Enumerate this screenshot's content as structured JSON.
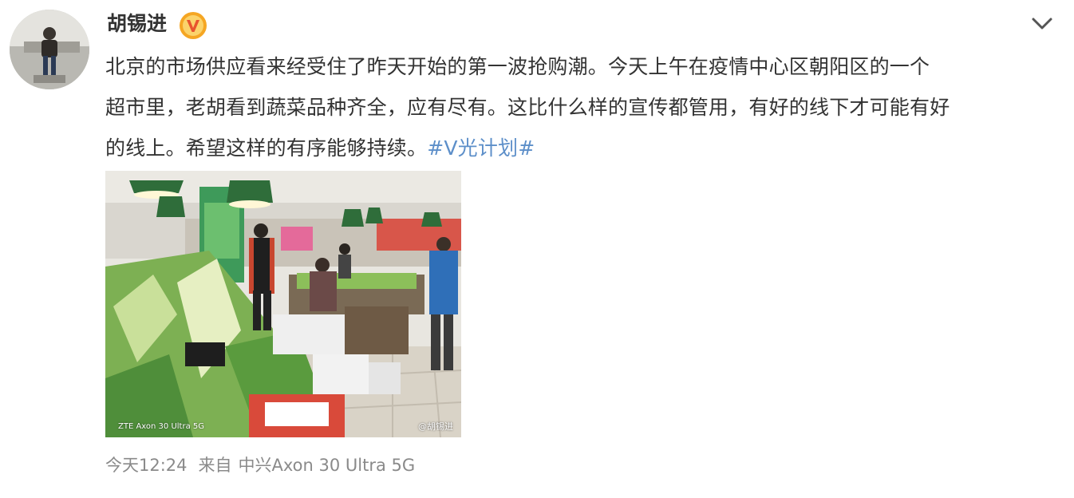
{
  "post": {
    "author": "胡锡进",
    "text_lines": [
      "北京的市场供应看来经受住了昨天开始的第一波抢购潮。今天上午在疫情中心区朝阳区的一个",
      "超市里，老胡看到蔬菜品种齐全，应有尽有。这比什么样的宣传都管用，有好的线下才可能有好",
      "的线上。希望这样的有序能够持续。"
    ],
    "topic": "#V光计划#",
    "image": {
      "watermark_camera": "ZTE  Axon 30 Ultra 5G",
      "watermark_user": "@胡锡进"
    },
    "time": "今天12:24",
    "source_prefix": "来自",
    "source_device": "中兴Axon 30 Ultra 5G"
  },
  "icons": {
    "verified": "verified-v-badge-icon",
    "collapse": "chevron-down-icon"
  },
  "colors": {
    "link": "#5d8fc9",
    "badge_orange": "#f5a623",
    "badge_red": "#e8542e",
    "meta_text": "#8a8a8a"
  }
}
